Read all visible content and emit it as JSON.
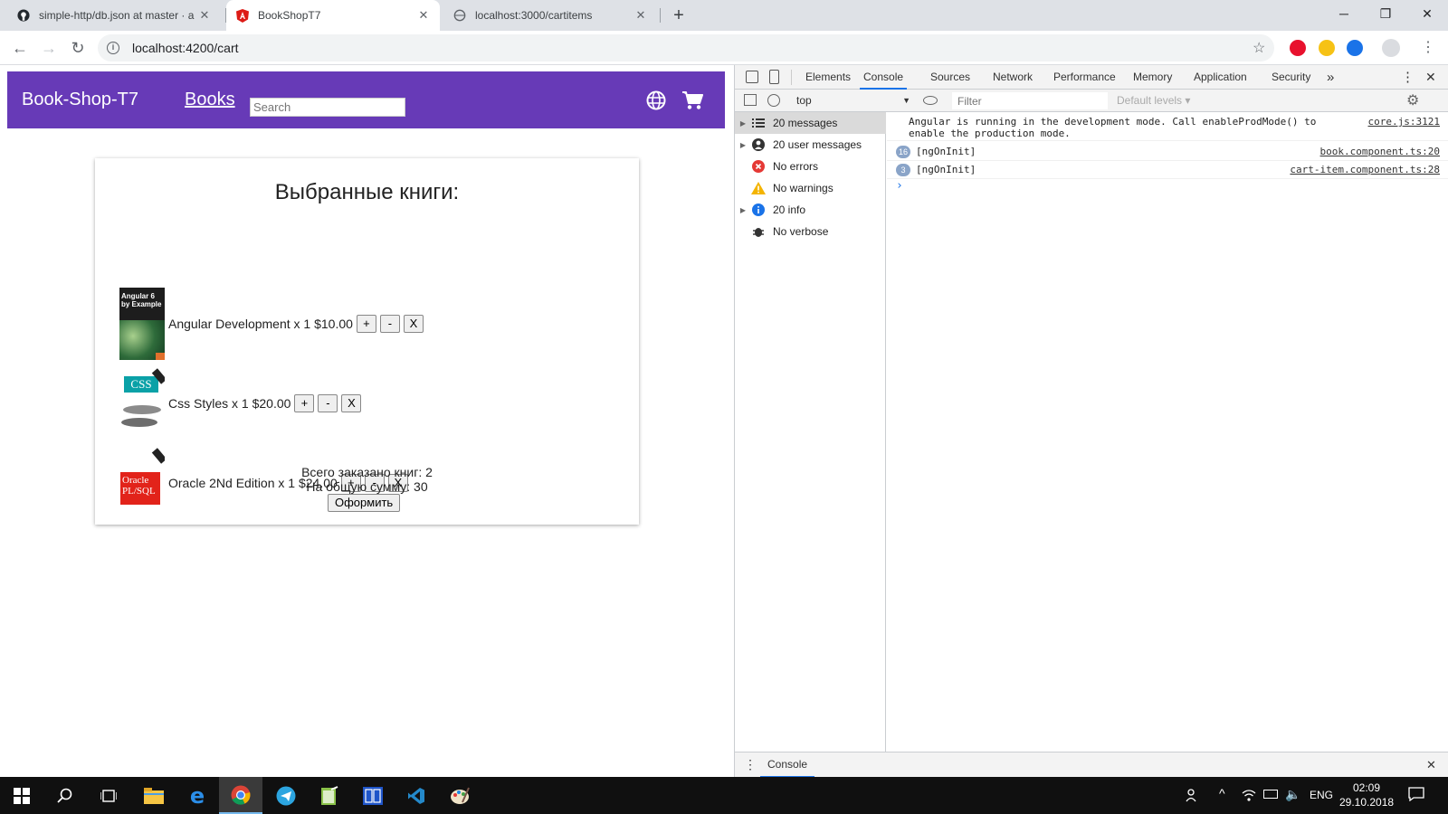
{
  "browser": {
    "tabs": [
      {
        "title": "simple-http/db.json at master · a",
        "favicon": "github-icon",
        "active": false
      },
      {
        "title": "BookShopT7",
        "favicon": "angular-icon",
        "active": true
      },
      {
        "title": "localhost:3000/cartitems",
        "favicon": "globe-icon",
        "active": false
      }
    ],
    "new_tab": "+",
    "url": "localhost:4200/cart"
  },
  "app": {
    "brand": "Book-Shop-T7",
    "nav_books": "Books",
    "search_placeholder": "Search",
    "header_color": "#673ab7",
    "cart": {
      "title": "Выбранные книги:",
      "items": [
        {
          "name": "Angular Development",
          "qty_text": "x 1",
          "price": "$10.00",
          "cover": "angular-cover",
          "cover_text": "Angular 6 by Example"
        },
        {
          "name": "Css Styles",
          "qty_text": "x 1",
          "price": "$20.00",
          "cover": "css-cover",
          "cover_text": "CSS"
        },
        {
          "name": "Oracle 2Nd Edition",
          "qty_text": "x 1",
          "price": "$24.00",
          "cover": "oracle-cover",
          "cover_text": "Oracle PL/SQL"
        }
      ],
      "btn_plus": "+",
      "btn_minus": "-",
      "btn_remove": "X",
      "total_books": "Всего заказано книг: 2",
      "total_sum": "На общую сумму: 30",
      "checkout": "Оформить"
    }
  },
  "devtools": {
    "tabs": [
      "Elements",
      "Console",
      "Sources",
      "Network",
      "Performance",
      "Memory",
      "Application",
      "Security"
    ],
    "active_tab": "Console",
    "more": "»",
    "context": "top",
    "filter_placeholder": "Filter",
    "levels": "Default levels ▾",
    "sidebar": [
      {
        "label": "20 messages",
        "icon": "list-icon",
        "expandable": true
      },
      {
        "label": "20 user messages",
        "icon": "user-icon",
        "expandable": true
      },
      {
        "label": "No errors",
        "icon": "error-icon",
        "expandable": false
      },
      {
        "label": "No warnings",
        "icon": "warning-icon",
        "expandable": false
      },
      {
        "label": "20 info",
        "icon": "info-icon",
        "expandable": true
      },
      {
        "label": "No verbose",
        "icon": "bug-icon",
        "expandable": false
      }
    ],
    "console": [
      {
        "text": "Angular is running in the development mode. Call enableProdMode() to enable the production mode.",
        "source": "core.js:3121",
        "count": ""
      },
      {
        "text": "[ngOnInit]",
        "source": "book.component.ts:20",
        "count": "16"
      },
      {
        "text": "[ngOnInit]",
        "source": "cart-item.component.ts:28",
        "count": "3"
      }
    ],
    "prompt": "›",
    "drawer_tab": "Console"
  },
  "taskbar": {
    "lang": "ENG",
    "time": "02:09",
    "date": "29.10.2018"
  }
}
